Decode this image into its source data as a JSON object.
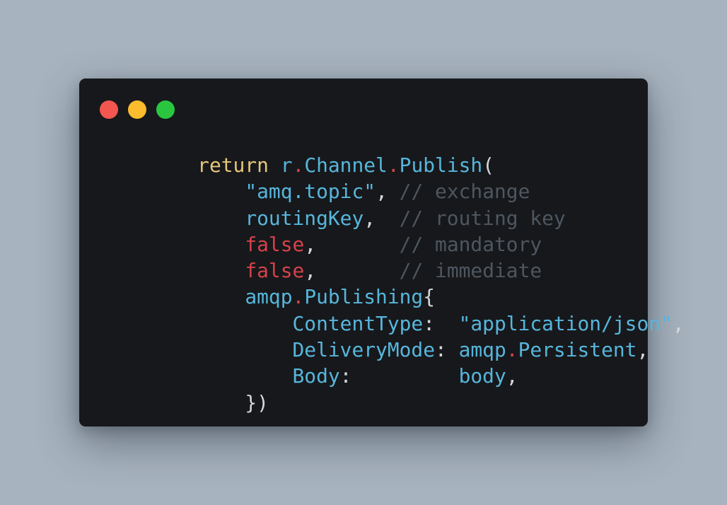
{
  "window_controls": [
    {
      "name": "close",
      "color": "#f2564f"
    },
    {
      "name": "minimize",
      "color": "#fbbc2d"
    },
    {
      "name": "maximize",
      "color": "#2ac640"
    }
  ],
  "colors": {
    "keyword": "#e6c87a",
    "identifier": "#56b6dc",
    "string": "#56b6dc",
    "operator": "#d6424a",
    "boolean": "#d6424a",
    "comment": "#4e565f",
    "punctuation": "#d6d7d9"
  },
  "code_lines": [
    [
      {
        "t": "    ",
        "c": "punctuation"
      },
      {
        "t": "return",
        "c": "keyword"
      },
      {
        "t": " ",
        "c": "punctuation"
      },
      {
        "t": "r",
        "c": "identifier"
      },
      {
        "t": ".",
        "c": "operator"
      },
      {
        "t": "Channel",
        "c": "identifier"
      },
      {
        "t": ".",
        "c": "operator"
      },
      {
        "t": "Publish",
        "c": "identifier"
      },
      {
        "t": "(",
        "c": "punctuation"
      }
    ],
    [
      {
        "t": "        ",
        "c": "punctuation"
      },
      {
        "t": "\"amq.topic\"",
        "c": "string"
      },
      {
        "t": ", ",
        "c": "punctuation"
      },
      {
        "t": "// exchange",
        "c": "comment"
      }
    ],
    [
      {
        "t": "        ",
        "c": "punctuation"
      },
      {
        "t": "routingKey",
        "c": "identifier"
      },
      {
        "t": ",  ",
        "c": "punctuation"
      },
      {
        "t": "// routing key",
        "c": "comment"
      }
    ],
    [
      {
        "t": "        ",
        "c": "punctuation"
      },
      {
        "t": "false",
        "c": "boolean"
      },
      {
        "t": ",       ",
        "c": "punctuation"
      },
      {
        "t": "// mandatory",
        "c": "comment"
      }
    ],
    [
      {
        "t": "        ",
        "c": "punctuation"
      },
      {
        "t": "false",
        "c": "boolean"
      },
      {
        "t": ",       ",
        "c": "punctuation"
      },
      {
        "t": "// immediate",
        "c": "comment"
      }
    ],
    [
      {
        "t": "        ",
        "c": "punctuation"
      },
      {
        "t": "amqp",
        "c": "identifier"
      },
      {
        "t": ".",
        "c": "operator"
      },
      {
        "t": "Publishing",
        "c": "identifier"
      },
      {
        "t": "{",
        "c": "punctuation"
      }
    ],
    [
      {
        "t": "            ",
        "c": "punctuation"
      },
      {
        "t": "ContentType",
        "c": "identifier"
      },
      {
        "t": ":  ",
        "c": "punctuation"
      },
      {
        "t": "\"application/json\"",
        "c": "string"
      },
      {
        "t": ",",
        "c": "punctuation"
      }
    ],
    [
      {
        "t": "            ",
        "c": "punctuation"
      },
      {
        "t": "DeliveryMode",
        "c": "identifier"
      },
      {
        "t": ": ",
        "c": "punctuation"
      },
      {
        "t": "amqp",
        "c": "identifier"
      },
      {
        "t": ".",
        "c": "operator"
      },
      {
        "t": "Persistent",
        "c": "identifier"
      },
      {
        "t": ",",
        "c": "punctuation"
      }
    ],
    [
      {
        "t": "            ",
        "c": "punctuation"
      },
      {
        "t": "Body",
        "c": "identifier"
      },
      {
        "t": ":         ",
        "c": "punctuation"
      },
      {
        "t": "body",
        "c": "identifier"
      },
      {
        "t": ",",
        "c": "punctuation"
      }
    ],
    [
      {
        "t": "        ",
        "c": "punctuation"
      },
      {
        "t": "})",
        "c": "punctuation"
      }
    ]
  ]
}
